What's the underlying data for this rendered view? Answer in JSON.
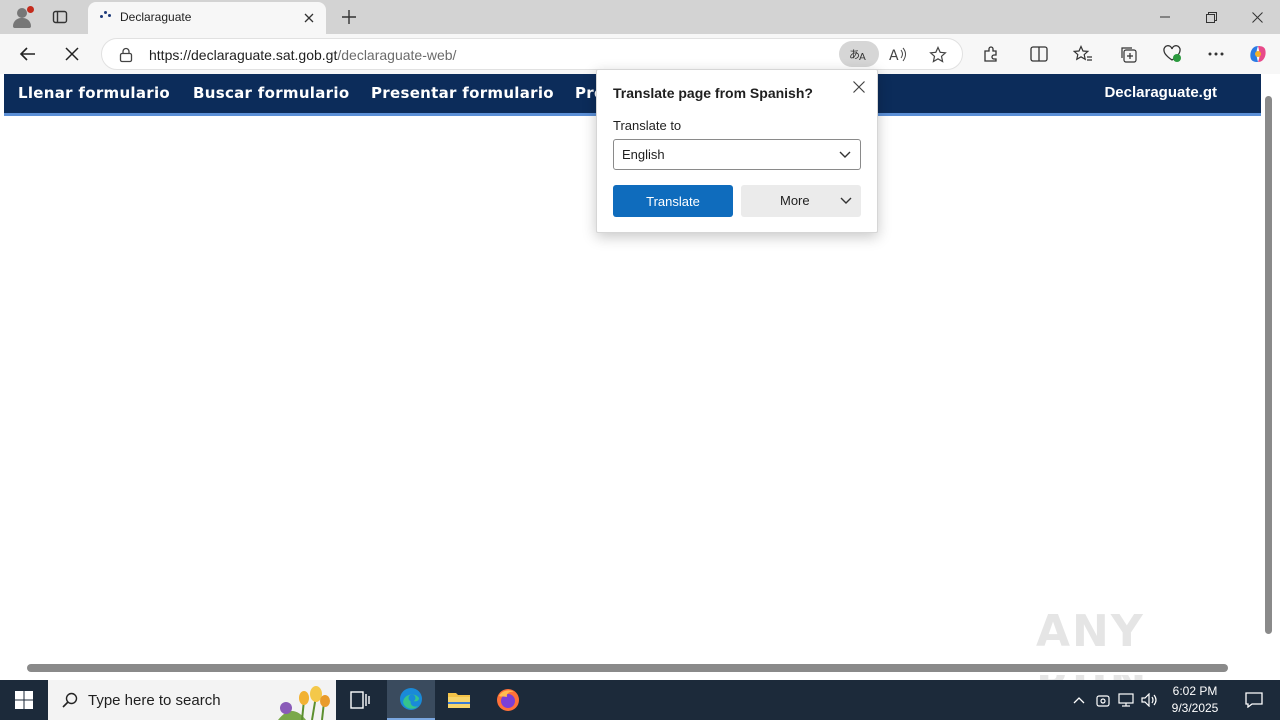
{
  "browser": {
    "tab": {
      "title": "Declaraguate"
    },
    "url": {
      "host": "https://declaraguate.sat.gob.gt",
      "path": "/declaraguate-web/"
    }
  },
  "site": {
    "nav": [
      {
        "label": "Llenar formulario"
      },
      {
        "label": "Buscar formulario"
      },
      {
        "label": "Presentar formulario"
      },
      {
        "label": "Pre"
      }
    ],
    "brand": "Declaraguate.gt",
    "colors": {
      "navbar": "#0c2c5a",
      "navbar_underline": "#5b8fd6"
    }
  },
  "translate_popup": {
    "title": "Translate page from Spanish?",
    "target_label": "Translate to",
    "target_value": "English",
    "translate_button": "Translate",
    "more_button": "More",
    "accent": "#0f6cbd"
  },
  "watermark": "ANY RUN",
  "taskbar": {
    "search_placeholder": "Type here to search",
    "time": "6:02 PM",
    "date": "9/3/2025"
  }
}
